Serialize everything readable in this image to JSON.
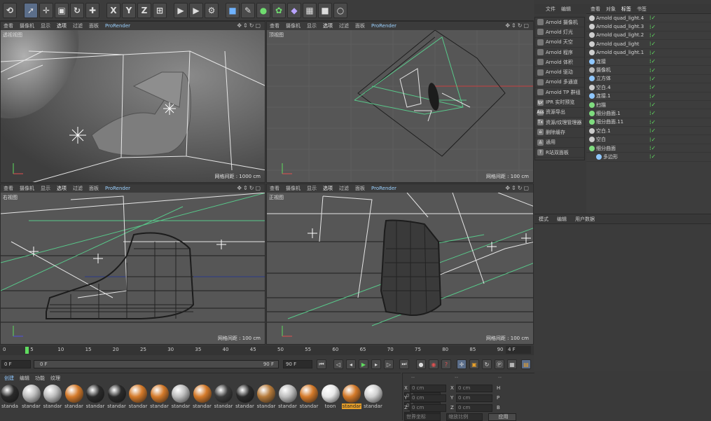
{
  "toolbar": {
    "buttons": [
      "undo",
      "select",
      "move",
      "scale",
      "rotate",
      "move-all",
      "x-axis",
      "y-axis",
      "z-axis",
      "coord",
      "render-view",
      "render-picture",
      "render-settings",
      "cube",
      "pen",
      "subdivision",
      "generator",
      "deformer",
      "floor",
      "camera",
      "light"
    ],
    "axis_labels": [
      "X",
      "Y",
      "Z"
    ]
  },
  "viewport_menu": [
    "查看",
    "摄像机",
    "显示",
    "选项",
    "过滤",
    "面板",
    "ProRender"
  ],
  "viewports": [
    {
      "label": "透视视图",
      "grid": "网格间距 : 1000 cm"
    },
    {
      "label": "顶视图",
      "grid": "网格间距 : 100 cm"
    },
    {
      "label": "右视图",
      "grid": "网格间距 : 100 cm"
    },
    {
      "label": "正视图",
      "grid": "网格间距 : 100 cm"
    }
  ],
  "main_menu": [
    "文件",
    "编辑",
    "查看",
    "对象",
    "标签",
    "书签"
  ],
  "arnold_menu": [
    "Arnold 摄像机",
    "Arnold 灯光",
    "Arnold 天空",
    "Arnold 程序",
    "Arnold 体积",
    "Arnold 驱动",
    "Arnold 多通道",
    "Arnold TP 群组",
    "IPR 实时预览",
    "资源导出",
    "资源/纹理管理器",
    "删除缓存",
    "通用",
    "R站双面板"
  ],
  "arnold_icons": [
    "Ipr",
    "Ass",
    "Tx",
    "⌂",
    "♙",
    "?"
  ],
  "objects": [
    {
      "name": "Arnold quad_light.4",
      "color": "#cfcfcf",
      "indent": 0
    },
    {
      "name": "Arnold quad_light.3",
      "color": "#cfcfcf",
      "indent": 0
    },
    {
      "name": "Arnold quad_light.2",
      "color": "#cfcfcf",
      "indent": 0
    },
    {
      "name": "Arnold quad_light",
      "color": "#cfcfcf",
      "indent": 0
    },
    {
      "name": "Arnold quad_light.1",
      "color": "#cfcfcf",
      "indent": 0
    },
    {
      "name": "连接",
      "color": "#8fc7ff",
      "indent": 0
    },
    {
      "name": "摄像机",
      "color": "#bbbbbb",
      "indent": 0
    },
    {
      "name": "立方体",
      "color": "#8fc7ff",
      "indent": 0
    },
    {
      "name": "空白.4",
      "color": "#cccccc",
      "indent": 0
    },
    {
      "name": "连接.1",
      "color": "#8fc7ff",
      "indent": 0
    },
    {
      "name": "扫描",
      "color": "#7fdc7f",
      "indent": 0
    },
    {
      "name": "细分曲面.1",
      "color": "#7fdc7f",
      "indent": 0
    },
    {
      "name": "细分曲面.11",
      "color": "#7fdc7f",
      "indent": 0
    },
    {
      "name": "空白.1",
      "color": "#cccccc",
      "indent": 0
    },
    {
      "name": "空白",
      "color": "#cccccc",
      "indent": 0
    },
    {
      "name": "细分曲面",
      "color": "#7fdc7f",
      "indent": 0
    },
    {
      "name": "多边形",
      "color": "#8fc7ff",
      "indent": 1
    }
  ],
  "attr_menu": [
    "模式",
    "编辑",
    "用户数据"
  ],
  "timeline": {
    "ticks": [
      "0",
      "5",
      "10",
      "15",
      "20",
      "25",
      "30",
      "35",
      "40",
      "45",
      "50",
      "55",
      "60",
      "65",
      "70",
      "75",
      "80",
      "85",
      "90"
    ],
    "current_frame": "4 F"
  },
  "playbar": {
    "start": "0 F",
    "range_start": "0 F",
    "range_end": "90 F",
    "end": "90 F"
  },
  "material_menu": [
    "创建",
    "编辑",
    "功能",
    "纹理"
  ],
  "materials": [
    {
      "name": "standa",
      "color": "#2a2a2a"
    },
    {
      "name": "standar",
      "color": "#bdbdbd"
    },
    {
      "name": "standar",
      "color": "#bdbdbd"
    },
    {
      "name": "standar",
      "color": "#d47a2a"
    },
    {
      "name": "standar",
      "color": "#2a2a2a"
    },
    {
      "name": "standar",
      "color": "#2a2a2a"
    },
    {
      "name": "standar",
      "color": "#d47a2a"
    },
    {
      "name": "standar",
      "color": "#d47a2a"
    },
    {
      "name": "standar",
      "color": "#bdbdbd"
    },
    {
      "name": "standar",
      "color": "#d47a2a"
    },
    {
      "name": "standar",
      "color": "#3a3a3a"
    },
    {
      "name": "standar",
      "color": "#2a2a2a"
    },
    {
      "name": "standar",
      "color": "#b57a3a"
    },
    {
      "name": "standar",
      "color": "#bdbdbd"
    },
    {
      "name": "standar",
      "color": "#d47a2a"
    },
    {
      "name": "toon",
      "color": "#e8e8e8"
    },
    {
      "name": "standar",
      "color": "#d47a2a"
    },
    {
      "name": "standar",
      "color": "#cfcfcf"
    }
  ],
  "coords": {
    "headers": [
      "--",
      "--",
      "--"
    ],
    "rows": [
      {
        "axis": "X",
        "v1": "0 cm",
        "axis2": "X",
        "v2": "0 cm",
        "axis3": "H",
        "v3": "0 °"
      },
      {
        "axis": "Y",
        "v1": "0 cm",
        "axis2": "Y",
        "v2": "0 cm",
        "axis3": "P",
        "v3": "0 °"
      },
      {
        "axis": "Z",
        "v1": "0 cm",
        "axis2": "Z",
        "v2": "0 cm",
        "axis3": "B",
        "v3": "0 °"
      }
    ],
    "apply": "应用",
    "world": "世界坐标",
    "scale": "缩放比例"
  },
  "colors": {
    "accent": "#5b6e8a",
    "green_check": "#5fdc5f",
    "selected_material": "#e8a02a"
  }
}
